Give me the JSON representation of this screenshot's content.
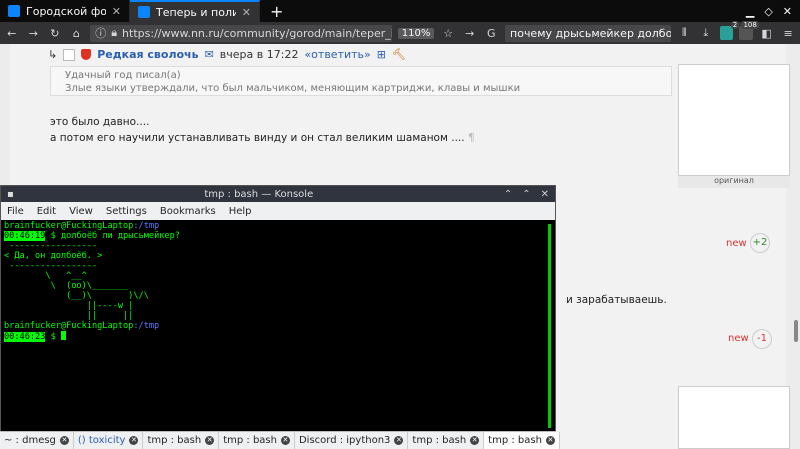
{
  "browser": {
    "tabs": [
      {
        "title": "Городской форум Ниж",
        "close": "✕",
        "active": false
      },
      {
        "title": "Теперь и полимерокол",
        "close": "✕",
        "active": true
      }
    ],
    "new_tab": "+",
    "url": "https://www.nn.ru/community/gorod/main/teper_i_polimerokolonka.htm",
    "zoom": "110%",
    "search_value": "почему дрысьмейкер долбоё",
    "addon_badges": [
      "2",
      "108"
    ]
  },
  "post": {
    "author": "Редкая сволочь",
    "time": "вчера в 17:22",
    "reply": "«ответить»",
    "quote_author": "Удачный год писал(а)",
    "quote_text": "Злые языки утверждали, что был мальчиком, меняющим картриджи, клавы и мышки",
    "line1": "это было давно....",
    "line2": "а потом его научили устанавливать винду и он стал великим шаманом ....",
    "para_mark": "¶",
    "image_caption": "оригинал"
  },
  "page_right": {
    "new1": "new",
    "score1": "+2",
    "fragment": "и зарабатываешь.",
    "new2": "new",
    "score2": "-1"
  },
  "konsole": {
    "title": "tmp : bash — Konsole",
    "menu": [
      "File",
      "Edit",
      "View",
      "Settings",
      "Bookmarks",
      "Help"
    ],
    "prompt_user": "brainfucker@FuckingLaptop",
    "prompt_path": ":/tmp",
    "time1": "00:46:19",
    "command": "долбоёб ли дрысьмейкер?",
    "cow_lines": [
      " -----------------",
      "< Да, он долбоёб. >",
      " -----------------",
      "        \\   ^__^",
      "         \\  (oo)\\_______",
      "            (__)\\       )\\/\\",
      "                ||----w |",
      "                ||     ||"
    ],
    "time2": "00:46:23",
    "dollar": "$",
    "tabs": [
      {
        "label": "~ : dmesg",
        "active": false
      },
      {
        "label": "() toxicity",
        "active": false
      },
      {
        "label": "tmp : bash",
        "active": false
      },
      {
        "label": "tmp : bash",
        "active": false
      },
      {
        "label": "Discord : ipython3",
        "active": false
      },
      {
        "label": "tmp : bash",
        "active": false
      },
      {
        "label": "tmp : bash",
        "active": true
      }
    ]
  },
  "colors": {
    "terminal_green": "#00ff00",
    "browser_accent": "#0a84ff",
    "author_link": "#2a5fb0",
    "new_label": "#dd3333"
  }
}
